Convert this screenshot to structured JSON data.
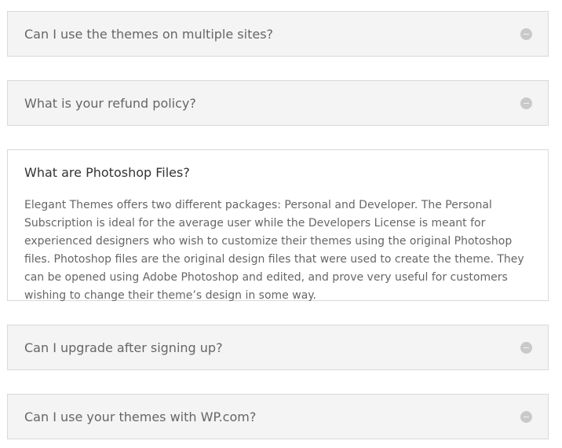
{
  "faq": {
    "items": [
      {
        "question": "Can I use the themes on multiple sites?",
        "state": "collapsed",
        "icon": "minus-circle-icon"
      },
      {
        "question": "What is your refund policy?",
        "state": "collapsed",
        "icon": "minus-circle-icon"
      },
      {
        "question": "What are Photoshop Files?",
        "state": "expanded",
        "answer": "Elegant Themes offers two different packages: Personal and Developer. The Personal Subscription is ideal for the average user while the Developers License is meant for experienced designers who wish to customize their themes using the original Photoshop files. Photoshop files are the original design files that were used to create the theme. They can be opened using Adobe Photoshop and edited, and prove very useful for customers wishing to change their theme’s design in some way."
      },
      {
        "question": "Can I upgrade after signing up?",
        "state": "collapsed",
        "icon": "minus-circle-icon"
      },
      {
        "question": "Can I use your themes with WP.com?",
        "state": "collapsed",
        "icon": "minus-circle-icon"
      }
    ]
  },
  "colors": {
    "closed_background": "#f4f4f4",
    "open_background": "#ffffff",
    "border": "#d9d9d9",
    "text": "#666666",
    "icon": "#c9c9c9"
  }
}
